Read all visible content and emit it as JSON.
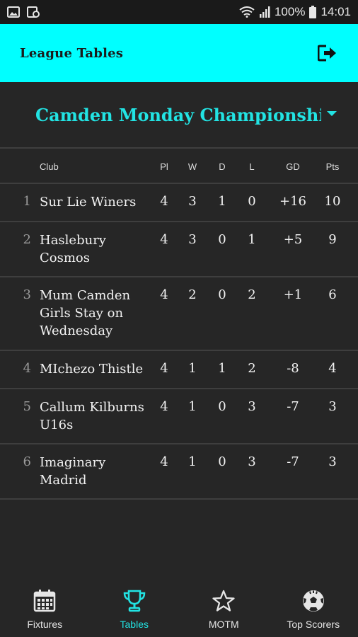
{
  "status_bar": {
    "battery": "100%",
    "time": "14:01"
  },
  "app_bar": {
    "title": "League Tables"
  },
  "league": {
    "name": "Camden Monday Championship"
  },
  "table": {
    "headers": {
      "club": "Club",
      "pl": "Pl",
      "w": "W",
      "d": "D",
      "l": "L",
      "gd": "GD",
      "pts": "Pts"
    },
    "rows": [
      {
        "rank": "1",
        "club": "Sur Lie Winers",
        "pl": "4",
        "w": "3",
        "d": "1",
        "l": "0",
        "gd": "+16",
        "pts": "10"
      },
      {
        "rank": "2",
        "club": "Haslebury Cosmos",
        "pl": "4",
        "w": "3",
        "d": "0",
        "l": "1",
        "gd": "+5",
        "pts": "9"
      },
      {
        "rank": "3",
        "club": "Mum Camden Girls Stay on Wednesday",
        "pl": "4",
        "w": "2",
        "d": "0",
        "l": "2",
        "gd": "+1",
        "pts": "6"
      },
      {
        "rank": "4",
        "club": "MIchezo Thistle",
        "pl": "4",
        "w": "1",
        "d": "1",
        "l": "2",
        "gd": "-8",
        "pts": "4"
      },
      {
        "rank": "5",
        "club": "Callum Kilburns U16s",
        "pl": "4",
        "w": "1",
        "d": "0",
        "l": "3",
        "gd": "-7",
        "pts": "3"
      },
      {
        "rank": "6",
        "club": "Imaginary Madrid",
        "pl": "4",
        "w": "1",
        "d": "0",
        "l": "3",
        "gd": "-7",
        "pts": "3"
      }
    ]
  },
  "bottom_nav": {
    "items": [
      {
        "label": "Fixtures",
        "icon": "calendar-icon"
      },
      {
        "label": "Tables",
        "icon": "trophy-icon"
      },
      {
        "label": "MOTM",
        "icon": "star-icon"
      },
      {
        "label": "Top Scorers",
        "icon": "soccer-ball-icon"
      }
    ],
    "active": "Tables"
  },
  "colors": {
    "accent": "#00ffff",
    "accent_text": "#22e3e3",
    "background": "#262626"
  }
}
